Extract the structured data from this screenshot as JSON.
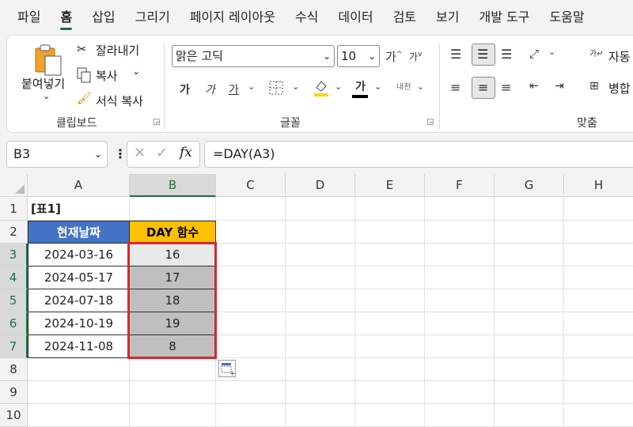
{
  "menu": {
    "items": [
      "파일",
      "홈",
      "삽입",
      "그리기",
      "페이지 레이아웃",
      "수식",
      "데이터",
      "검토",
      "보기",
      "개발 도구",
      "도움말"
    ],
    "active_index": 1
  },
  "ribbon": {
    "clipboard": {
      "paste_label": "붙여넣기",
      "cut_label": "잘라내기",
      "copy_label": "복사",
      "format_painter_label": "서식 복사",
      "group_label": "클립보드"
    },
    "font": {
      "font_name": "맑은 고딕",
      "font_size": "10",
      "grow_label": "가",
      "shrink_label": "가",
      "bold_label": "가",
      "italic_label": "가",
      "underline_label": "가",
      "font_color_label": "가",
      "phonetic_label": "내천",
      "group_label": "글꼴",
      "fill_color": "#ffd200",
      "font_color": "#000000"
    },
    "alignment": {
      "wrap_label": "자동",
      "merge_label": "병합",
      "group_label": "맞춤"
    }
  },
  "formula_bar": {
    "name_box": "B3",
    "formula": "=DAY(A3)"
  },
  "sheet": {
    "columns": [
      "A",
      "B",
      "C",
      "D",
      "E",
      "F",
      "G",
      "H"
    ],
    "selected_column": "B",
    "rows": [
      "1",
      "2",
      "3",
      "4",
      "5",
      "6",
      "7",
      "8",
      "9",
      "10"
    ],
    "selected_rows": [
      "3",
      "4",
      "5",
      "6",
      "7"
    ],
    "title_cell": "[표1]",
    "header_a": "현재날짜",
    "header_b": "DAY 함수",
    "data": [
      {
        "date": "2024-03-16",
        "day": "16"
      },
      {
        "date": "2024-05-17",
        "day": "17"
      },
      {
        "date": "2024-07-18",
        "day": "18"
      },
      {
        "date": "2024-10-19",
        "day": "19"
      },
      {
        "date": "2024-11-08",
        "day": "8"
      }
    ],
    "colors": {
      "header_a_bg": "#4472c4",
      "header_b_bg": "#ffc000",
      "selection_border": "#d9262e",
      "accent": "#1e7145"
    }
  }
}
